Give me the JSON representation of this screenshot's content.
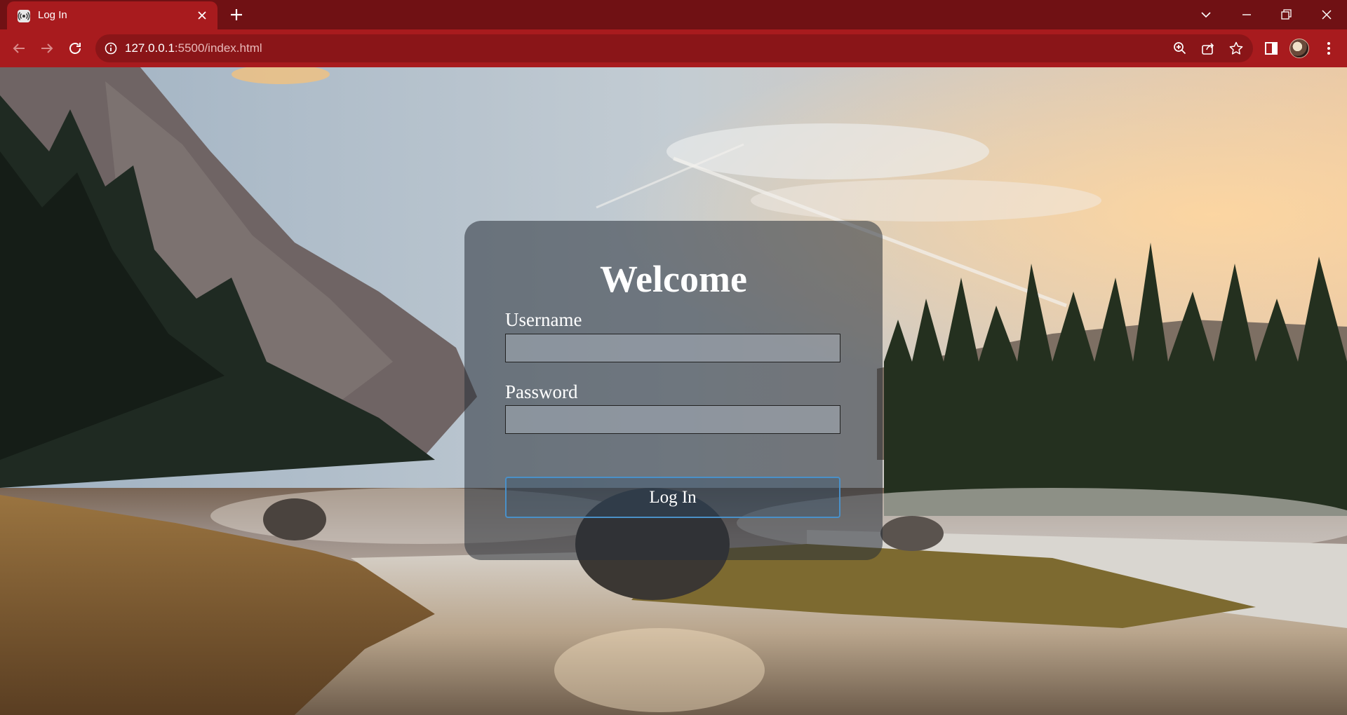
{
  "browser": {
    "tab_title": "Log In",
    "url_host": "127.0.0.1",
    "url_rest": ":5500/index.html",
    "theme_color": "#a81b1e",
    "tabstrip_color": "#701114",
    "icons": {
      "favicon": "broadcast-icon",
      "tab_close": "close-icon",
      "new_tab": "plus-icon",
      "tab_search": "chevron-down-icon",
      "minimize": "minimize-icon",
      "restore": "restore-icon",
      "close_window": "close-icon",
      "back": "arrow-left-icon",
      "forward": "arrow-right-icon",
      "reload": "reload-icon",
      "site_info": "info-icon",
      "zoom": "zoom-icon",
      "share": "share-icon",
      "bookmark": "star-icon",
      "side_panel": "side-panel-icon",
      "profile": "avatar",
      "menu": "kebab-menu-icon"
    }
  },
  "login": {
    "title": "Welcome",
    "username_label": "Username",
    "username_value": "",
    "password_label": "Password",
    "password_value": "",
    "submit_label": "Log In",
    "button_border_color": "#4a90c8"
  }
}
